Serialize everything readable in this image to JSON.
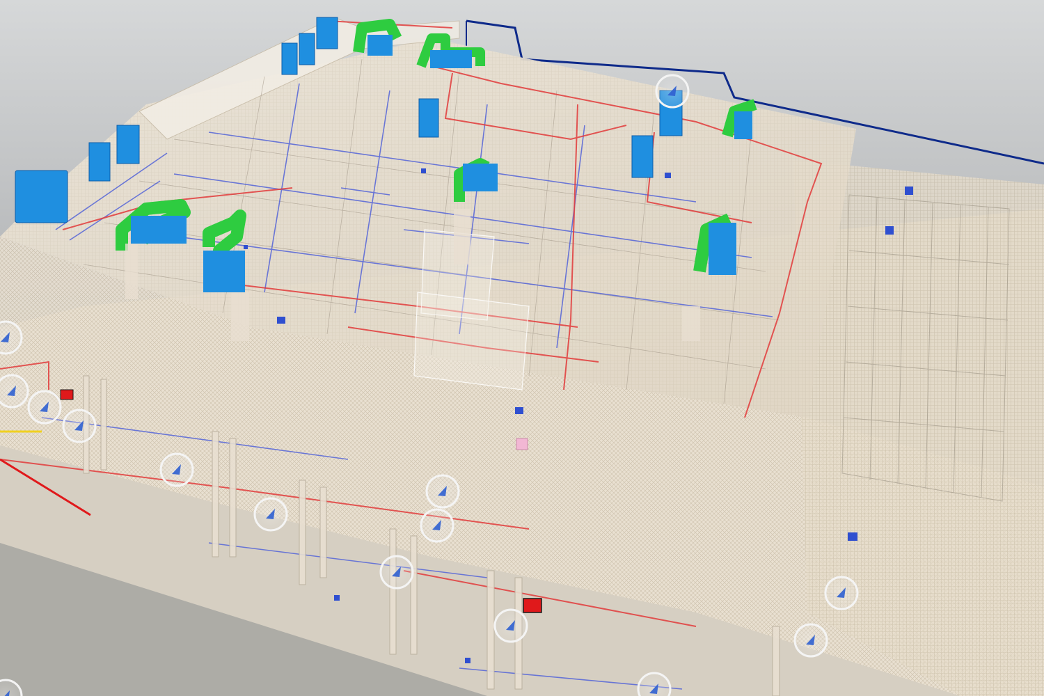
{
  "viewer": {
    "colors": {
      "background_top": "#c9cbcc",
      "background_bottom": "#6f7173",
      "ground": "#d8d1c4",
      "structure": "#e6ddcf",
      "mesh": "#efe7d9",
      "duct_blue": "#2a8fe0",
      "duct_green": "#2ecc40",
      "pipe_red": "#e23b3b",
      "pipe_blue": "#5060d8",
      "boundary_navy": "#0e2a8a",
      "marker_ring": "#f4f4f4",
      "marker_glyph": "#2f5fd0",
      "clash_red": "#e0191b"
    },
    "markers": [
      {
        "id": "m1",
        "icon": "model-marker-icon"
      },
      {
        "id": "m2",
        "icon": "model-marker-icon"
      },
      {
        "id": "m3",
        "icon": "model-marker-icon"
      },
      {
        "id": "m4",
        "icon": "model-marker-icon"
      },
      {
        "id": "m5",
        "icon": "model-marker-icon"
      },
      {
        "id": "m6",
        "icon": "model-marker-icon"
      },
      {
        "id": "m7",
        "icon": "model-marker-icon"
      },
      {
        "id": "m8",
        "icon": "model-marker-icon"
      },
      {
        "id": "m9",
        "icon": "model-marker-icon"
      },
      {
        "id": "m10",
        "icon": "model-marker-icon"
      },
      {
        "id": "m11",
        "icon": "model-marker-icon"
      },
      {
        "id": "m12",
        "icon": "model-marker-icon"
      },
      {
        "id": "m13",
        "icon": "model-marker-icon"
      },
      {
        "id": "m14",
        "icon": "model-marker-icon"
      },
      {
        "id": "m15",
        "icon": "model-marker-icon"
      }
    ]
  }
}
